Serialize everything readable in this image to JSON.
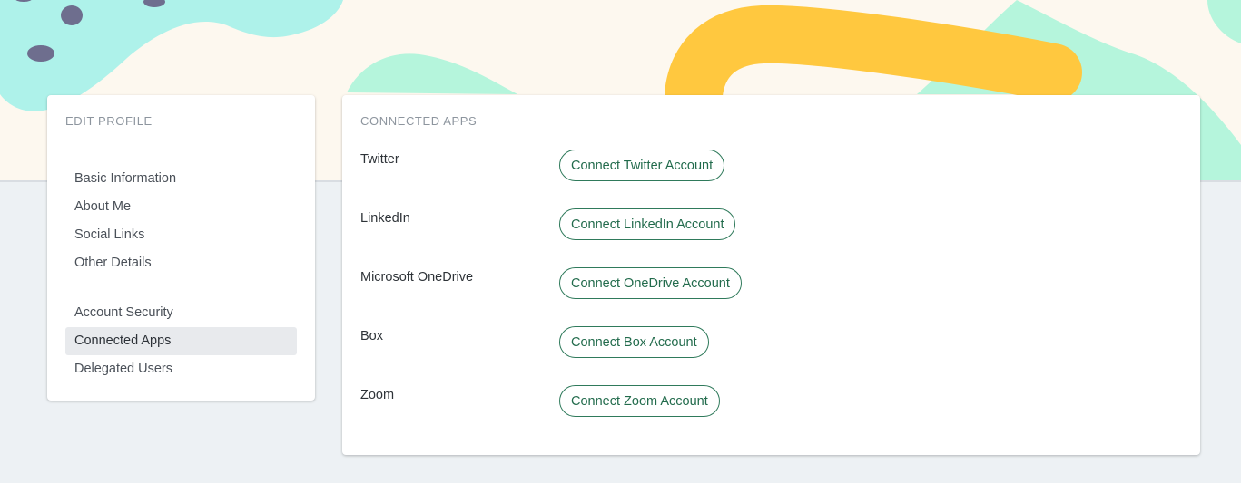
{
  "sidebar": {
    "heading": "EDIT PROFILE",
    "group1": [
      {
        "label": "Basic Information"
      },
      {
        "label": "About Me"
      },
      {
        "label": "Social Links"
      },
      {
        "label": "Other Details"
      }
    ],
    "group2": [
      {
        "label": "Account Security"
      },
      {
        "label": "Connected Apps",
        "active": true
      },
      {
        "label": "Delegated Users"
      }
    ]
  },
  "main": {
    "heading": "CONNECTED APPS",
    "apps": [
      {
        "name": "Twitter",
        "button": "Connect Twitter Account"
      },
      {
        "name": "LinkedIn",
        "button": "Connect LinkedIn Account"
      },
      {
        "name": "Microsoft OneDrive",
        "button": "Connect OneDrive Account"
      },
      {
        "name": "Box",
        "button": "Connect Box Account"
      },
      {
        "name": "Zoom",
        "button": "Connect Zoom Account"
      }
    ]
  },
  "colors": {
    "accent": "#2f7a5b",
    "page_background": "#edf1f4",
    "active_nav": "#e8eaed",
    "banner_cream": "#fdf8ef",
    "banner_cyan": "#aef2ea",
    "banner_mint": "#b5f5dc",
    "banner_yellow": "#ffc83f",
    "banner_dots": "#6e6e8e"
  }
}
